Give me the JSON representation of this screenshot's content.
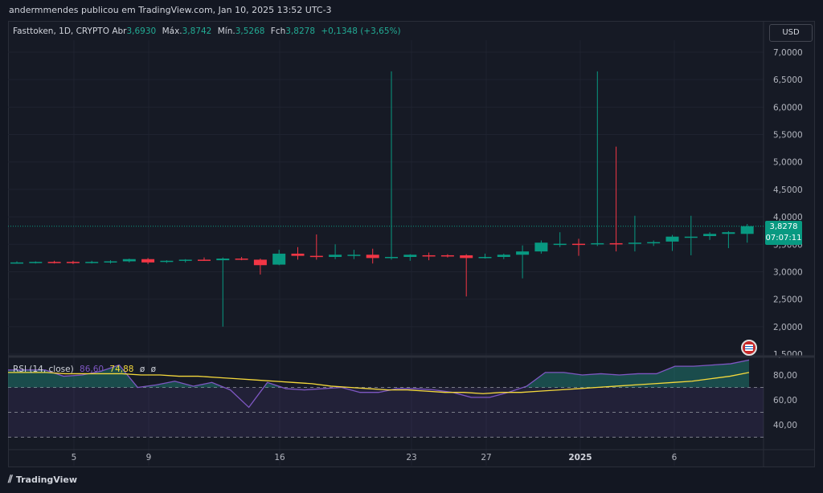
{
  "header": {
    "publisher_text": "andermmendes publicou em TradingView.com, Jan 10, 2025 13:52 UTC-3"
  },
  "legend": {
    "symbol": "Fasttoken, 1D, CRYPTO",
    "open_label": "Abr",
    "open": "3,6930",
    "high_label": "Máx.",
    "high": "3,8742",
    "low_label": "Mín.",
    "low": "3,5268",
    "close_label": "Fch",
    "close": "3,8278",
    "change": "+0,1348 (+3,65%)"
  },
  "currency_button": "USD",
  "price_tag": {
    "price": "3,8278",
    "countdown": "07:07:11"
  },
  "rsi": {
    "label": "RSI (14, close)",
    "value1": "86,60",
    "value2": "74,88",
    "extra1": "ø",
    "extra2": "ø"
  },
  "footer": {
    "brand": "TradingView"
  },
  "colors": {
    "up": "#089981",
    "down": "#f23645",
    "rsi_line": "#7e57c2",
    "rsi_ma": "#f5d93c",
    "bg": "#161a25"
  },
  "chart_data": [
    {
      "type": "candlestick",
      "title": "Fasttoken, 1D, CRYPTO",
      "ylim": [
        1.5,
        7.2
      ],
      "y_ticks": [
        "7,0000",
        "6,5000",
        "6,0000",
        "5,5000",
        "5,0000",
        "4,5000",
        "4,0000",
        "3,5000",
        "3,0000",
        "2,5000",
        "2,0000",
        "1,5000"
      ],
      "x_ticks": [
        "5",
        "9",
        "16",
        "23",
        "27",
        "2025",
        "6"
      ],
      "x_tick_index": [
        4,
        8,
        15,
        22,
        26,
        32,
        37
      ],
      "candles": [
        {
          "o": 3.17,
          "h": 3.19,
          "l": 3.15,
          "c": 3.17
        },
        {
          "o": 3.17,
          "h": 3.19,
          "l": 3.15,
          "c": 3.18
        },
        {
          "o": 3.18,
          "h": 3.2,
          "l": 3.15,
          "c": 3.17
        },
        {
          "o": 3.18,
          "h": 3.2,
          "l": 3.14,
          "c": 3.16
        },
        {
          "o": 3.17,
          "h": 3.2,
          "l": 3.15,
          "c": 3.18
        },
        {
          "o": 3.18,
          "h": 3.21,
          "l": 3.15,
          "c": 3.19
        },
        {
          "o": 3.19,
          "h": 3.24,
          "l": 3.17,
          "c": 3.23
        },
        {
          "o": 3.23,
          "h": 3.25,
          "l": 3.14,
          "c": 3.17
        },
        {
          "o": 3.18,
          "h": 3.21,
          "l": 3.16,
          "c": 3.2
        },
        {
          "o": 3.2,
          "h": 3.23,
          "l": 3.17,
          "c": 3.22
        },
        {
          "o": 3.22,
          "h": 3.26,
          "l": 3.2,
          "c": 3.21
        },
        {
          "o": 3.21,
          "h": 3.26,
          "l": 2.0,
          "c": 3.24
        },
        {
          "o": 3.24,
          "h": 3.27,
          "l": 3.21,
          "c": 3.22
        },
        {
          "o": 3.22,
          "h": 3.24,
          "l": 2.95,
          "c": 3.12
        },
        {
          "o": 3.13,
          "h": 3.4,
          "l": 3.12,
          "c": 3.33
        },
        {
          "o": 3.33,
          "h": 3.45,
          "l": 3.22,
          "c": 3.29
        },
        {
          "o": 3.29,
          "h": 3.68,
          "l": 3.22,
          "c": 3.27
        },
        {
          "o": 3.27,
          "h": 3.5,
          "l": 3.23,
          "c": 3.31
        },
        {
          "o": 3.3,
          "h": 3.4,
          "l": 3.23,
          "c": 3.31
        },
        {
          "o": 3.31,
          "h": 3.42,
          "l": 3.15,
          "c": 3.25
        },
        {
          "o": 3.25,
          "h": 6.65,
          "l": 3.22,
          "c": 3.27
        },
        {
          "o": 3.27,
          "h": 3.32,
          "l": 3.2,
          "c": 3.31
        },
        {
          "o": 3.3,
          "h": 3.35,
          "l": 3.21,
          "c": 3.29
        },
        {
          "o": 3.3,
          "h": 3.32,
          "l": 3.26,
          "c": 3.29
        },
        {
          "o": 3.3,
          "h": 3.32,
          "l": 2.55,
          "c": 3.25
        },
        {
          "o": 3.27,
          "h": 3.33,
          "l": 3.24,
          "c": 3.27
        },
        {
          "o": 3.27,
          "h": 3.33,
          "l": 3.23,
          "c": 3.31
        },
        {
          "o": 3.31,
          "h": 3.48,
          "l": 2.88,
          "c": 3.37
        },
        {
          "o": 3.37,
          "h": 3.57,
          "l": 3.33,
          "c": 3.53
        },
        {
          "o": 3.51,
          "h": 3.72,
          "l": 3.45,
          "c": 3.51
        },
        {
          "o": 3.51,
          "h": 3.6,
          "l": 3.29,
          "c": 3.5
        },
        {
          "o": 3.5,
          "h": 6.65,
          "l": 3.47,
          "c": 3.52
        },
        {
          "o": 3.52,
          "h": 5.28,
          "l": 3.37,
          "c": 3.51
        },
        {
          "o": 3.51,
          "h": 4.02,
          "l": 3.37,
          "c": 3.53
        },
        {
          "o": 3.53,
          "h": 3.57,
          "l": 3.47,
          "c": 3.54
        },
        {
          "o": 3.55,
          "h": 3.67,
          "l": 3.38,
          "c": 3.64
        },
        {
          "o": 3.63,
          "h": 4.02,
          "l": 3.3,
          "c": 3.64
        },
        {
          "o": 3.65,
          "h": 3.72,
          "l": 3.58,
          "c": 3.69
        },
        {
          "o": 3.69,
          "h": 3.74,
          "l": 3.43,
          "c": 3.72
        },
        {
          "o": 3.69,
          "h": 3.87,
          "l": 3.53,
          "c": 3.83
        }
      ]
    },
    {
      "type": "line",
      "title": "RSI (14, close)",
      "ylim": [
        30,
        90
      ],
      "y_ticks": [
        "80,00",
        "60,00",
        "40,00"
      ],
      "bands": [
        70,
        50,
        30
      ],
      "series": [
        {
          "name": "86,60",
          "values": [
            84,
            84,
            84,
            79,
            80,
            83,
            88,
            70,
            72,
            75,
            71,
            74,
            68,
            54,
            74,
            69,
            68,
            69,
            70,
            66,
            66,
            69,
            69,
            68,
            66,
            62,
            62,
            66,
            71,
            82,
            82,
            80,
            81,
            80,
            81,
            81,
            87,
            87,
            88,
            89,
            92
          ]
        },
        {
          "name": "74,88",
          "values": [
            82,
            82,
            82,
            81,
            81,
            81,
            81,
            80,
            80,
            79,
            79,
            78,
            77,
            76,
            75,
            74,
            73,
            71,
            70,
            69,
            68,
            68,
            67,
            66,
            66,
            65,
            66,
            66,
            67,
            68,
            69,
            70,
            71,
            72,
            73,
            74,
            75,
            77,
            79,
            82
          ]
        }
      ]
    }
  ]
}
